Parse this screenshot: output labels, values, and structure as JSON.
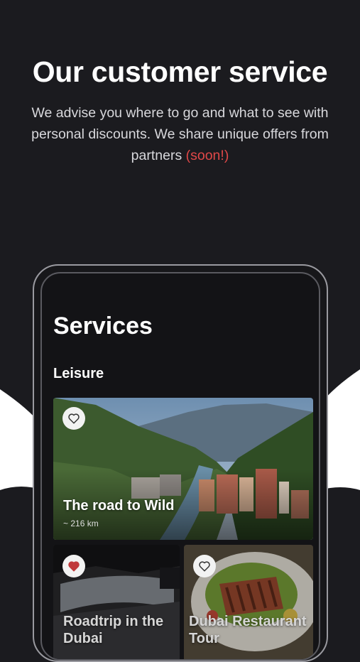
{
  "header": {
    "title": "Our customer service",
    "subtitle": "We advise you where to go and what to see with personal discounts. We share unique offers from partners",
    "subtitle_accent": "(soon!)"
  },
  "screen": {
    "title": "Services",
    "section": "Leisure",
    "cards": [
      {
        "title": "The road to Wild",
        "subtitle": "~ 216 km",
        "favorite": false
      },
      {
        "title": "Roadtrip in the Dubai",
        "favorite": true
      },
      {
        "title": "Dubai Restaurant Tour",
        "favorite": false
      }
    ]
  },
  "colors": {
    "background": "#1b1b1f",
    "accent": "#e04848",
    "favorite_heart": "#c0393b"
  }
}
